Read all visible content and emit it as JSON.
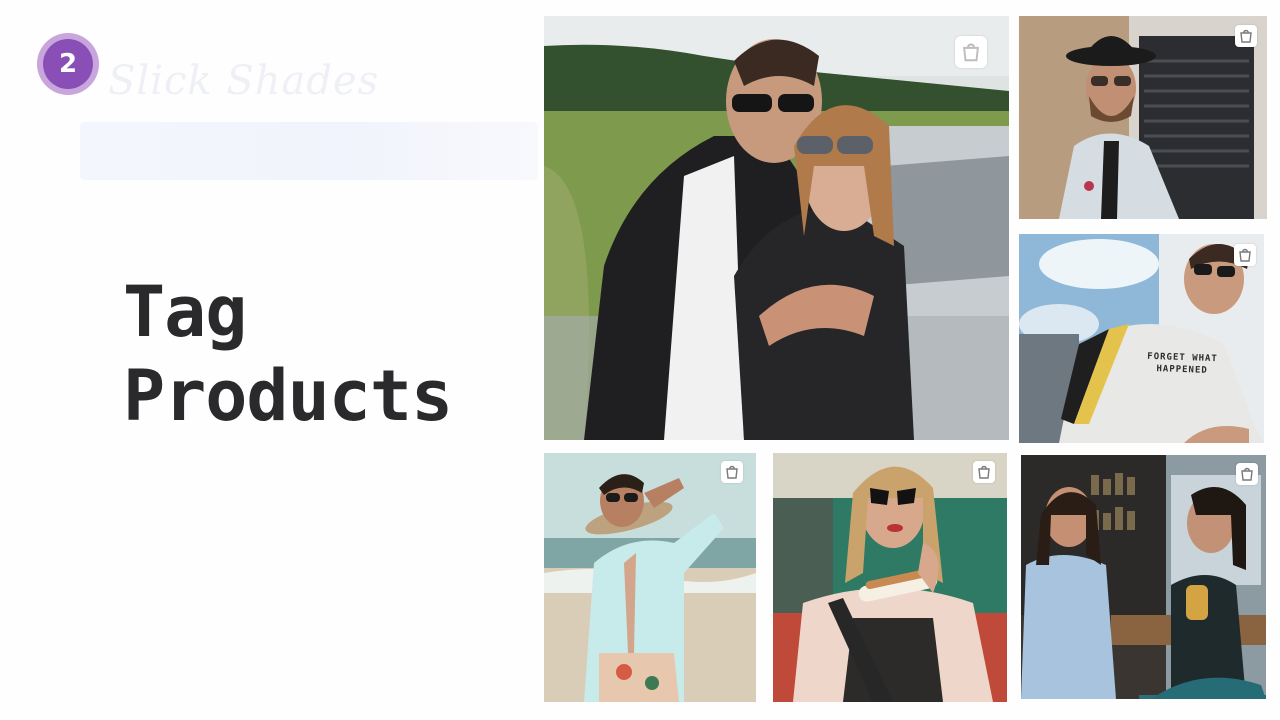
{
  "step": {
    "number": "2"
  },
  "ghost": {
    "title": "Slick Shades"
  },
  "heading": {
    "line1": "Tag",
    "line2": "Products"
  },
  "gallery": {
    "tiles": [
      {
        "subject": "couple-by-car"
      },
      {
        "subject": "man-in-hat"
      },
      {
        "subject": "man-graphic-tee",
        "tee_text_line1": "FORGET WHAT",
        "tee_text_line2": "HAPPENED"
      },
      {
        "subject": "man-on-beach"
      },
      {
        "subject": "woman-eating"
      },
      {
        "subject": "two-women-laughing"
      }
    ],
    "tag_icon": "shopping-bag-icon"
  },
  "colors": {
    "badge_outer": "#c8a6dc",
    "badge_inner": "#8a4eb7",
    "heading": "#2a2a2d"
  }
}
